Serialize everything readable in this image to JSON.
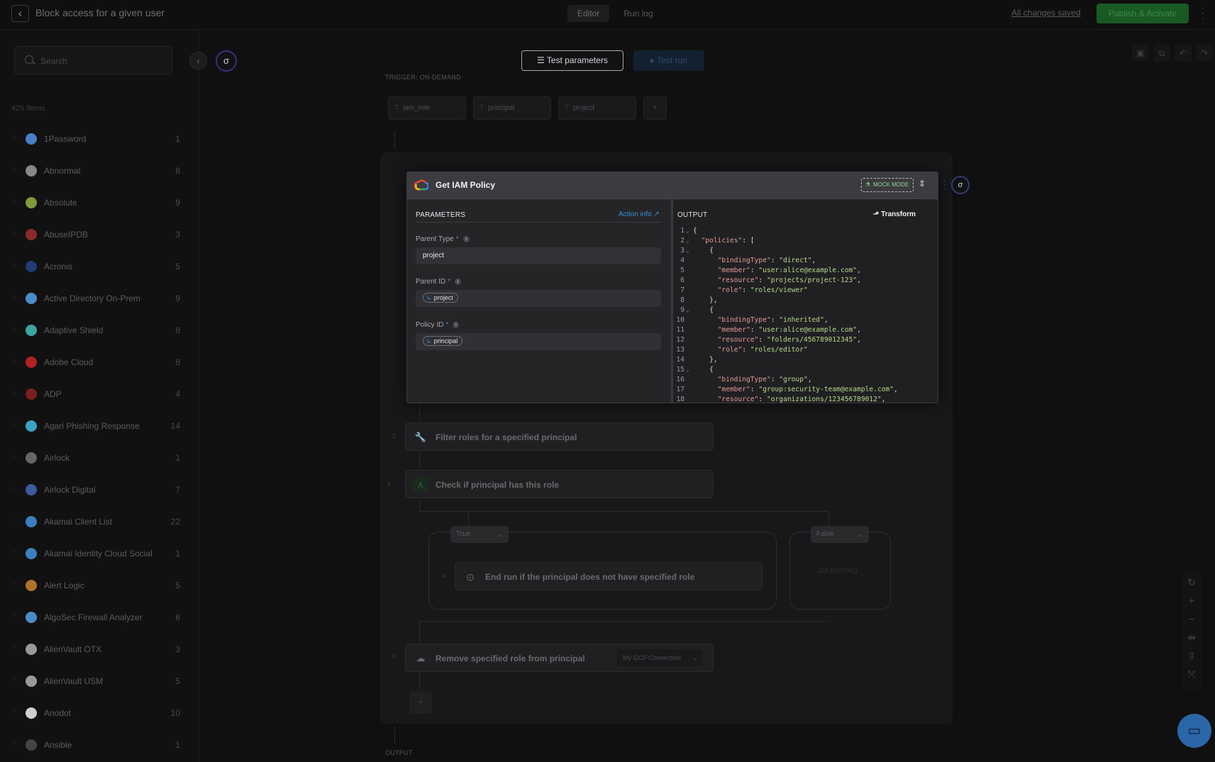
{
  "topbar": {
    "title": "Block access for a given user",
    "tabs": [
      {
        "label": "Editor"
      },
      {
        "label": "Run log"
      }
    ],
    "saved": "All changes saved",
    "publish": "Publish & Activate"
  },
  "sidebar": {
    "search_placeholder": "Search",
    "count": "425 items",
    "items": [
      {
        "name": "1Password",
        "count": "1",
        "color": "#4a7ec7"
      },
      {
        "name": "Abnormal",
        "count": "8",
        "color": "#888888"
      },
      {
        "name": "Absolute",
        "count": "9",
        "color": "#7d9c3a"
      },
      {
        "name": "AbuseIPDB",
        "count": "3",
        "color": "#8a2b2b"
      },
      {
        "name": "Acronis",
        "count": "5",
        "color": "#1f3b73"
      },
      {
        "name": "Active Directory On-Prem",
        "count": "9",
        "color": "#4a8cc7"
      },
      {
        "name": "Adaptive Shield",
        "count": "8",
        "color": "#3aa7a0"
      },
      {
        "name": "Adobe Cloud",
        "count": "8",
        "color": "#b32020"
      },
      {
        "name": "ADP",
        "count": "4",
        "color": "#7a1f1f"
      },
      {
        "name": "Agari Phishing Response",
        "count": "14",
        "color": "#3aa3c4"
      },
      {
        "name": "Airlock",
        "count": "1",
        "color": "#666666"
      },
      {
        "name": "Airlock Digital",
        "count": "7",
        "color": "#3b5b9e"
      },
      {
        "name": "Akamai Client List",
        "count": "22",
        "color": "#3c7fbf"
      },
      {
        "name": "Akamai Identity Cloud Social",
        "count": "1",
        "color": "#3c7fbf"
      },
      {
        "name": "Alert Logic",
        "count": "5",
        "color": "#b0722a"
      },
      {
        "name": "AlgoSec Firewall Analyzer",
        "count": "6",
        "color": "#4a8cc7"
      },
      {
        "name": "AlienVault OTX",
        "count": "3",
        "color": "#999999"
      },
      {
        "name": "AlienVault USM",
        "count": "5",
        "color": "#999999"
      },
      {
        "name": "Anodot",
        "count": "10",
        "color": "#cfcfcf"
      },
      {
        "name": "Ansible",
        "count": "1",
        "color": "#444444"
      }
    ]
  },
  "canvas": {
    "test_parameters": "Test parameters",
    "test_run": "Test run",
    "trigger_label": "TRIGGER: ON-DEMAND",
    "params": [
      "iam_role",
      "principal",
      "project"
    ],
    "output_label": "OUTPUT",
    "steps": {
      "filter": "Filter roles for a specified principal",
      "check": "Check if principal has this role",
      "end": "End run if the principal does not have specified role",
      "remove": "Remove specified role from principal"
    },
    "step_numbers": {
      "filter": "2",
      "check": "3",
      "end": "4",
      "remove": "5"
    },
    "branch_true": "True",
    "branch_false": "False",
    "do_nothing": "Do Nothing",
    "connection": "My GCP Connection"
  },
  "modal": {
    "title": "Get IAM Policy",
    "mock_mode": "MOCK MODE",
    "parameters_title": "PARAMETERS",
    "action_info": "Action info",
    "output_title": "OUTPUT",
    "transform": "Transform",
    "fields": [
      {
        "label": "Parent Type",
        "value": "project",
        "chip": false
      },
      {
        "label": "Parent ID",
        "value": "project",
        "chip": true
      },
      {
        "label": "Policy ID",
        "value": "principal",
        "chip": true
      }
    ],
    "code": [
      {
        "n": "1",
        "fold": true,
        "text": "{"
      },
      {
        "n": "2",
        "fold": true,
        "text": "  \"policies\": ["
      },
      {
        "n": "3",
        "fold": true,
        "text": "    {"
      },
      {
        "n": "4",
        "fold": false,
        "text": "      \"bindingType\": \"direct\","
      },
      {
        "n": "5",
        "fold": false,
        "text": "      \"member\": \"user:alice@example.com\","
      },
      {
        "n": "6",
        "fold": false,
        "text": "      \"resource\": \"projects/project-123\","
      },
      {
        "n": "7",
        "fold": false,
        "text": "      \"role\": \"roles/viewer\""
      },
      {
        "n": "8",
        "fold": false,
        "text": "    },"
      },
      {
        "n": "9",
        "fold": true,
        "text": "    {"
      },
      {
        "n": "10",
        "fold": false,
        "text": "      \"bindingType\": \"inherited\","
      },
      {
        "n": "11",
        "fold": false,
        "text": "      \"member\": \"user:alice@example.com\","
      },
      {
        "n": "12",
        "fold": false,
        "text": "      \"resource\": \"folders/456789012345\","
      },
      {
        "n": "13",
        "fold": false,
        "text": "      \"role\": \"roles/editor\""
      },
      {
        "n": "14",
        "fold": false,
        "text": "    },"
      },
      {
        "n": "15",
        "fold": true,
        "text": "    {"
      },
      {
        "n": "16",
        "fold": false,
        "text": "      \"bindingType\": \"group\","
      },
      {
        "n": "17",
        "fold": false,
        "text": "      \"member\": \"group:security-team@example.com\","
      },
      {
        "n": "18",
        "fold": false,
        "text": "      \"resource\": \"organizations/123456789012\","
      }
    ]
  }
}
